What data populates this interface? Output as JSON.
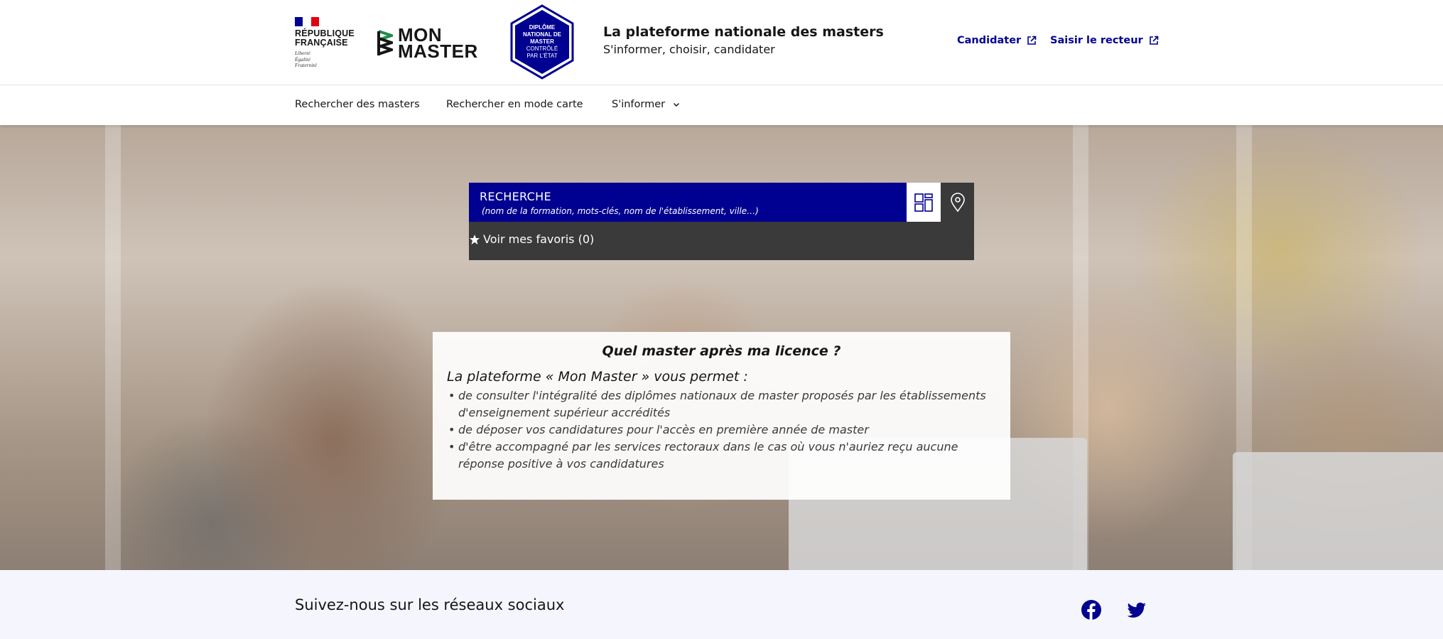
{
  "header": {
    "republique": [
      "RÉPUBLIQUE",
      "FRANÇAISE"
    ],
    "motto": [
      "Liberté",
      "Égalité",
      "Fraternité"
    ],
    "brand": [
      "MON",
      "MASTER"
    ],
    "badge": [
      "DIPLÔME",
      "NATIONAL DE",
      "MASTER",
      "CONTRÔLÉ",
      "PAR L'ÉTAT"
    ],
    "tagline_title": "La plateforme nationale des masters",
    "tagline_sub": "S'informer, choisir, candidater",
    "links": [
      {
        "label": "Candidater",
        "icon": "external-link-icon"
      },
      {
        "label": "Saisir le recteur",
        "icon": "external-link-icon"
      }
    ]
  },
  "nav": {
    "items": [
      {
        "label": "Rechercher des masters"
      },
      {
        "label": "Rechercher en mode carte"
      },
      {
        "label": "S'informer",
        "icon": "chevron-down-icon"
      }
    ]
  },
  "search": {
    "title": "RECHERCHE",
    "hint": "(nom de la formation, mots-clés, nom de l'établissement, ville…)",
    "grid_icon": "grid-view-icon",
    "map_icon": "map-pin-icon",
    "favorites_label": "Voir mes favoris (0)",
    "favorites_icon": "star-icon"
  },
  "info": {
    "question": "Quel master après ma licence ?",
    "lead": "La plateforme « Mon Master » vous permet :",
    "bullets": [
      "de consulter l'intégralité des diplômes nationaux de master proposés par les établissements d'enseignement supérieur accrédités",
      "de déposer vos candidatures pour l'accès en première année de master",
      "d'être accompagné par les services rectoraux dans le cas où vous n'auriez reçu aucune réponse positive à vos candidatures"
    ]
  },
  "social": {
    "title": "Suivez-nous sur les réseaux sociaux",
    "networks": [
      "facebook-icon",
      "twitter-icon"
    ]
  },
  "colors": {
    "accent": "#000091",
    "dark_panel": "#3a3a3a",
    "social_bg": "#f5f5fe",
    "brand_green": "#1f8d49"
  }
}
